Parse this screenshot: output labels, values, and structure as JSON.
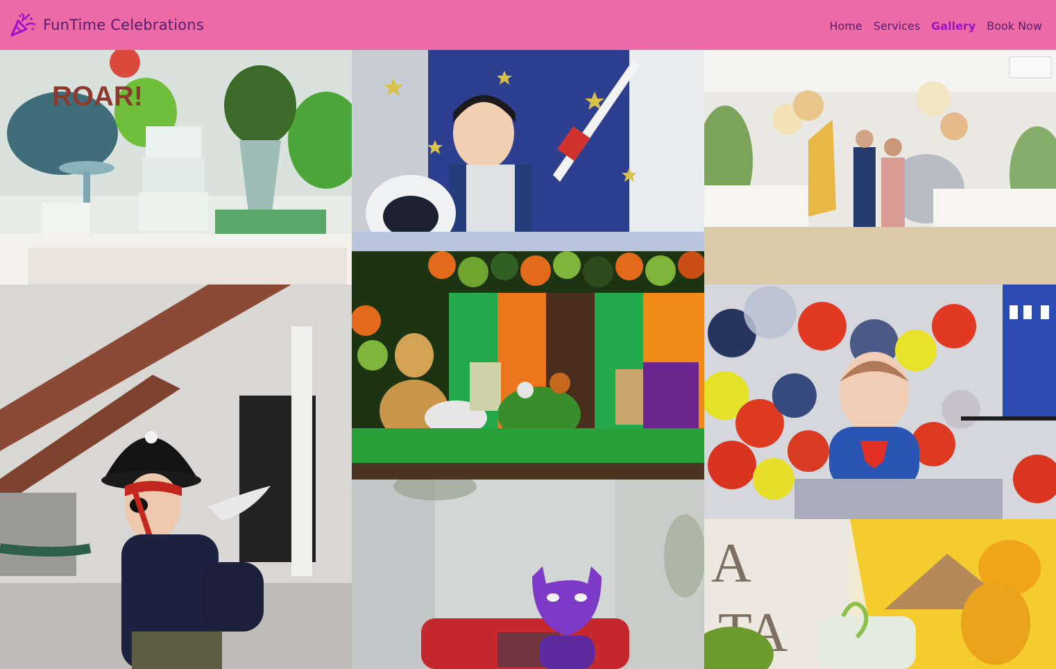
{
  "header": {
    "brand_name": "FunTime Celebrations",
    "logo_icon": "party-popper-icon",
    "background_color": "#ec6aa6",
    "text_color": "#5b1b68",
    "active_color": "#9a12c9"
  },
  "nav": {
    "items": [
      {
        "label": "Home",
        "active": false
      },
      {
        "label": "Services",
        "active": false
      },
      {
        "label": "Gallery",
        "active": true
      },
      {
        "label": "Book Now",
        "active": false
      }
    ]
  },
  "gallery": {
    "photos": [
      {
        "subject": "dinosaur-themed cake table"
      },
      {
        "subject": "child in astronaut tent"
      },
      {
        "subject": "safari party family"
      },
      {
        "subject": "child in pirate costume"
      },
      {
        "subject": "jungle animal cake table"
      },
      {
        "subject": "baby in superman outfit with balloons"
      },
      {
        "subject": "purple batman toy"
      },
      {
        "subject": "lion king cake"
      }
    ]
  }
}
